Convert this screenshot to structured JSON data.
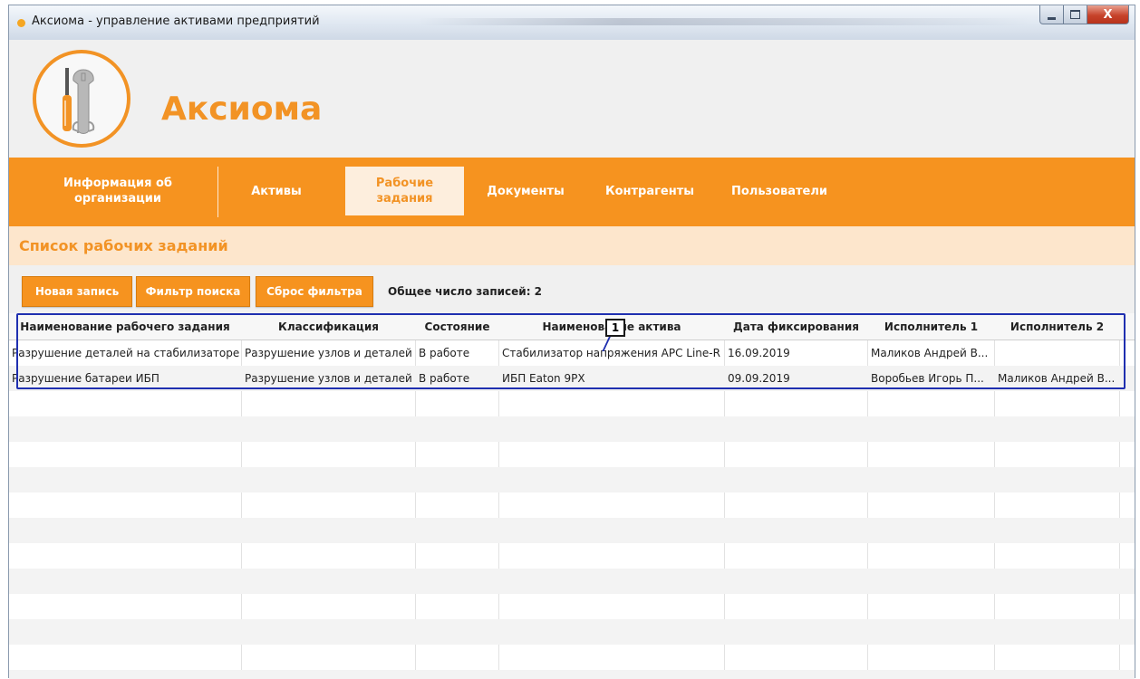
{
  "window": {
    "title": "Аксиома - управление активами предприятий",
    "controls": {
      "close_label": "X"
    }
  },
  "brand": {
    "name": "Аксиома",
    "logo_icon": "wrench-screwdriver-icon"
  },
  "nav": {
    "items": [
      {
        "label": "Информация об\nорганизации",
        "active": false
      },
      {
        "label": "Активы",
        "active": false
      },
      {
        "label": "Рабочие\nзадания",
        "active": true
      },
      {
        "label": "Документы",
        "active": false
      },
      {
        "label": "Контрагенты",
        "active": false
      },
      {
        "label": "Пользователи",
        "active": false
      }
    ]
  },
  "page": {
    "title": "Список рабочих заданий"
  },
  "toolbar": {
    "new_record": "Новая запись",
    "search_filter": "Фильтр поиска",
    "reset_filter": "Сброс фильтра",
    "total_label": "Общее число записей: 2"
  },
  "table": {
    "columns": [
      "Наименование рабочего задания",
      "Классификация",
      "Состояние",
      "Наименование актива",
      "Дата фиксирования",
      "Исполнитель 1",
      "Исполнитель 2"
    ],
    "rows": [
      [
        "Разрушение деталей на стабилизаторе",
        "Разрушение узлов и деталей",
        "В работе",
        "Стабилизатор напряжения APC Line-R",
        "16.09.2019",
        "Маликов Андрей В...",
        ""
      ],
      [
        "Разрушение батареи ИБП",
        "Разрушение узлов и деталей",
        "В работе",
        "ИБП Eaton 9PX",
        "09.09.2019",
        "Воробьев Игорь П...",
        "Маликов Андрей В..."
      ]
    ]
  },
  "annotation": {
    "callout_number": "1",
    "color": "#1f2fb0"
  },
  "colors": {
    "accent": "#f6931f",
    "brand_text": "#f29325",
    "section_bg": "#fde6cc"
  }
}
